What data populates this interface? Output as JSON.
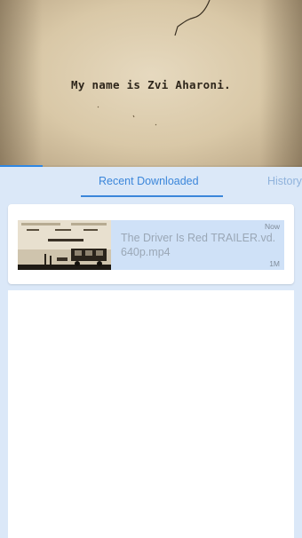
{
  "player": {
    "caption": "My name is Zvi Aharoni.",
    "progress": 0.14
  },
  "tabs": [
    {
      "label": "Recent Downloaded",
      "selected": true
    },
    {
      "label": "History",
      "selected": false
    }
  ],
  "downloads": [
    {
      "title": "The Driver Is Red TRAILER.vd.640p.mp4",
      "time": "Now",
      "size": "1M",
      "thumbnail": "video-thumbnail"
    }
  ],
  "colors": {
    "accent": "#3b86da",
    "background": "#dbe8f8",
    "item_highlight": "#cfe1f7"
  }
}
